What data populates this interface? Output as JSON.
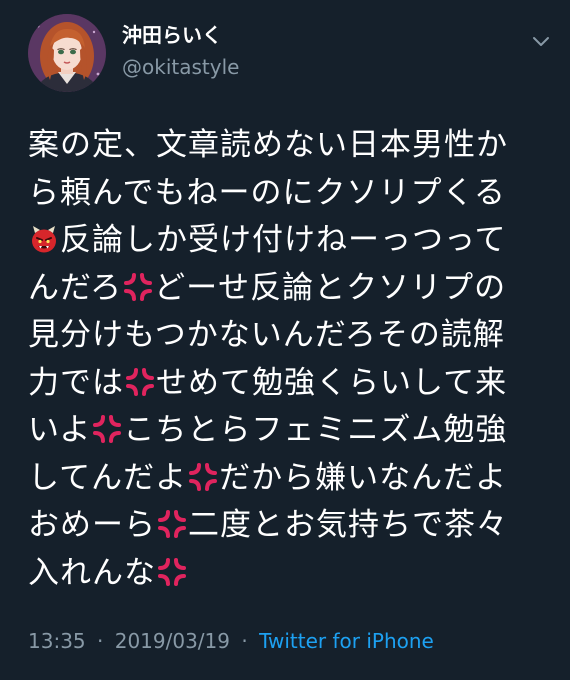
{
  "user": {
    "display_name": "沖田らいく",
    "handle": "@okitastyle"
  },
  "tweet": {
    "lines": [
      [
        {
          "t": "案の定、文章読めない日本男性か"
        }
      ],
      [
        {
          "t": "ら頼んでもねーのにクソリプくる"
        }
      ],
      [
        {
          "e": "ogre"
        },
        {
          "t": "反論しか受け付けねーっつって"
        }
      ],
      [
        {
          "t": "んだろ"
        },
        {
          "e": "anger"
        },
        {
          "t": "どーせ反論とクソリプの"
        }
      ],
      [
        {
          "t": "見分けもつかないんだろその読解"
        }
      ],
      [
        {
          "t": "力では"
        },
        {
          "e": "anger"
        },
        {
          "t": "せめて勉強くらいして来"
        }
      ],
      [
        {
          "t": "いよ"
        },
        {
          "e": "anger"
        },
        {
          "t": "こちとらフェミニズム勉強"
        }
      ],
      [
        {
          "t": "してんだよ"
        },
        {
          "e": "anger"
        },
        {
          "t": "だから嫌いなんだよ"
        }
      ],
      [
        {
          "t": "おめーら"
        },
        {
          "e": "anger"
        },
        {
          "t": "二度とお気持ちで茶々"
        }
      ],
      [
        {
          "t": "入れんな"
        },
        {
          "e": "anger"
        }
      ]
    ],
    "time": "13:35",
    "separator": "·",
    "date": "2019/03/19",
    "source": "Twitter for iPhone"
  },
  "icons": {
    "caret": "chevron-down-icon",
    "ogre": "japanese-ogre-emoji",
    "anger": "anger-symbol-emoji"
  },
  "colors": {
    "background": "#15202b",
    "text": "#ffffff",
    "secondary": "#8899a6",
    "link": "#1da1f2",
    "anger": "#e0245e"
  }
}
